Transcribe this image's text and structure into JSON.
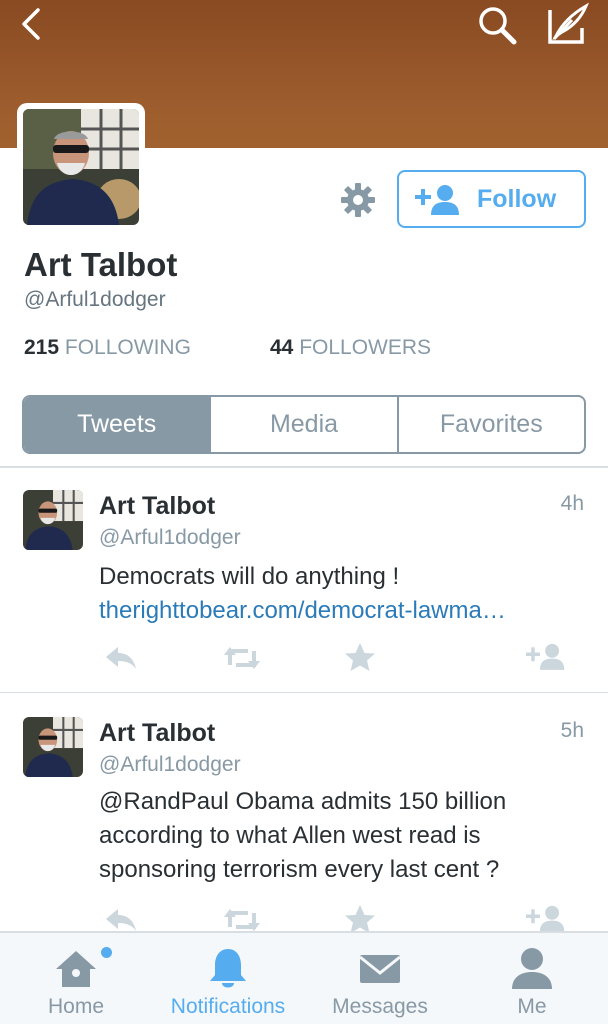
{
  "colors": {
    "banner": "#9a5a2c",
    "accent": "#55acee",
    "link": "#2b7bb9",
    "muted": "#8899a6",
    "text": "#292f33"
  },
  "header": {
    "back_icon": "chevron-left-icon",
    "search_icon": "search-icon",
    "compose_icon": "compose-feather-icon"
  },
  "profile": {
    "name": "Art Talbot",
    "handle": "@Arful1dodger",
    "following_count": "215",
    "following_label": "FOLLOWING",
    "followers_count": "44",
    "followers_label": "FOLLOWERS",
    "follow_label": "Follow",
    "settings_icon": "gear-icon"
  },
  "tabs": [
    {
      "label": "Tweets",
      "active": true
    },
    {
      "label": "Media",
      "active": false
    },
    {
      "label": "Favorites",
      "active": false
    }
  ],
  "tweets": [
    {
      "name": "Art Talbot",
      "handle": "@Arful1dodger",
      "time": "4h",
      "text": "Democrats will do anything !",
      "link": "therighttobear.com/democrat-lawma…"
    },
    {
      "name": "Art Talbot",
      "handle": "@Arful1dodger",
      "time": "5h",
      "text": "@RandPaul Obama admits 150 billion according to what Allen west read is sponsoring terrorism every last cent ?",
      "link": ""
    }
  ],
  "tabbar": [
    {
      "label": "Home",
      "icon": "home-icon",
      "active": false,
      "badge": true
    },
    {
      "label": "Notifications",
      "icon": "bell-icon",
      "active": true,
      "badge": false
    },
    {
      "label": "Messages",
      "icon": "envelope-icon",
      "active": false,
      "badge": false
    },
    {
      "label": "Me",
      "icon": "person-icon",
      "active": false,
      "badge": false
    }
  ]
}
